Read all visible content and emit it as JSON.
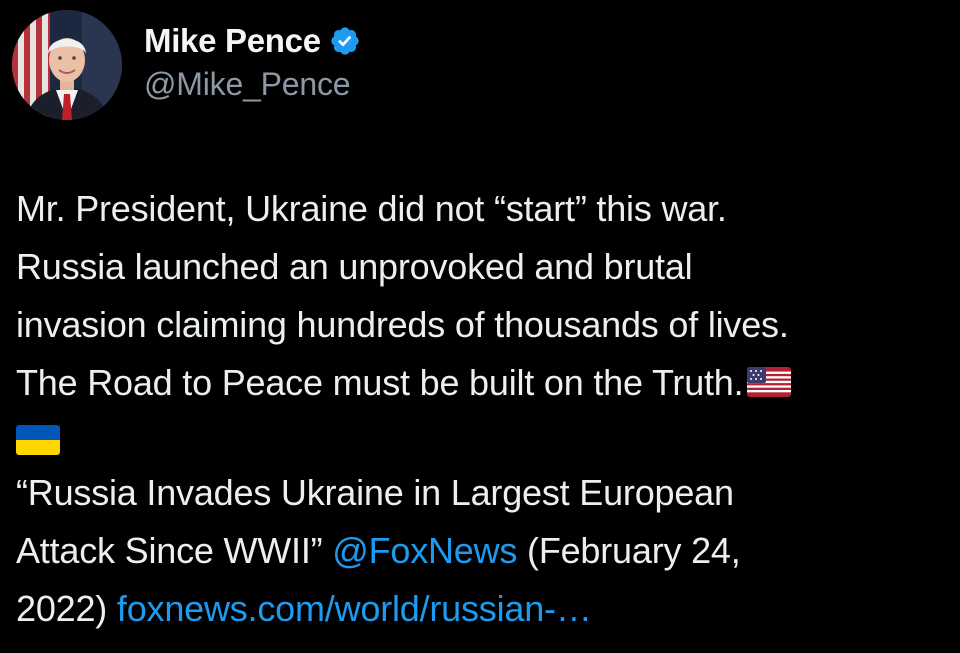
{
  "author": {
    "display_name": "Mike Pence",
    "handle": "@Mike_Pence",
    "verified_icon": "verified-badge-icon",
    "avatar_icon": "profile-photo-avatar"
  },
  "tweet": {
    "lines": [
      "Mr. President, Ukraine did not “start” this war.",
      "Russia launched an unprovoked and brutal",
      "invasion claiming hundreds of thousands of lives.",
      "The Road to Peace must be built on the Truth."
    ],
    "flag_1": "us-flag-emoji",
    "flag_2": "ukraine-flag-emoji",
    "quote_line_1": "“Russia Invades Ukraine in Largest European",
    "quote_line_2_a": "Attack Since WWII” ",
    "mention": "@FoxNews",
    "quote_line_2_b": " (February 24,",
    "quote_line_3_a": "2022) ",
    "link": "foxnews.com/world/russian-…"
  },
  "colors": {
    "background": "#000000",
    "text": "#eceff0",
    "muted": "#8b98a5",
    "link": "#1d9bf0",
    "verified": "#1d9bf0"
  }
}
